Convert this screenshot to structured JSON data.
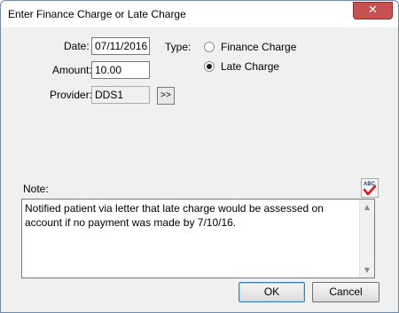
{
  "window": {
    "title": "Enter Finance Charge or Late Charge",
    "close_glyph": "✕"
  },
  "form": {
    "date_label": "Date:",
    "date_value": "07/11/2016",
    "amount_label": "Amount:",
    "amount_value": "10.00",
    "provider_label": "Provider:",
    "provider_value": "DDS1",
    "provider_browse_label": ">>",
    "type_label": "Type:",
    "type_options": [
      {
        "label": "Finance Charge",
        "selected": false
      },
      {
        "label": "Late Charge",
        "selected": true
      }
    ]
  },
  "note": {
    "label": "Note:",
    "text": "Notified patient via letter that late charge would be assessed on account if no payment was made by 7/10/16.",
    "spellcheck_icon": "spellcheck-icon",
    "spellcheck_text": "ABC"
  },
  "buttons": {
    "ok_label": "OK",
    "cancel_label": "Cancel"
  }
}
